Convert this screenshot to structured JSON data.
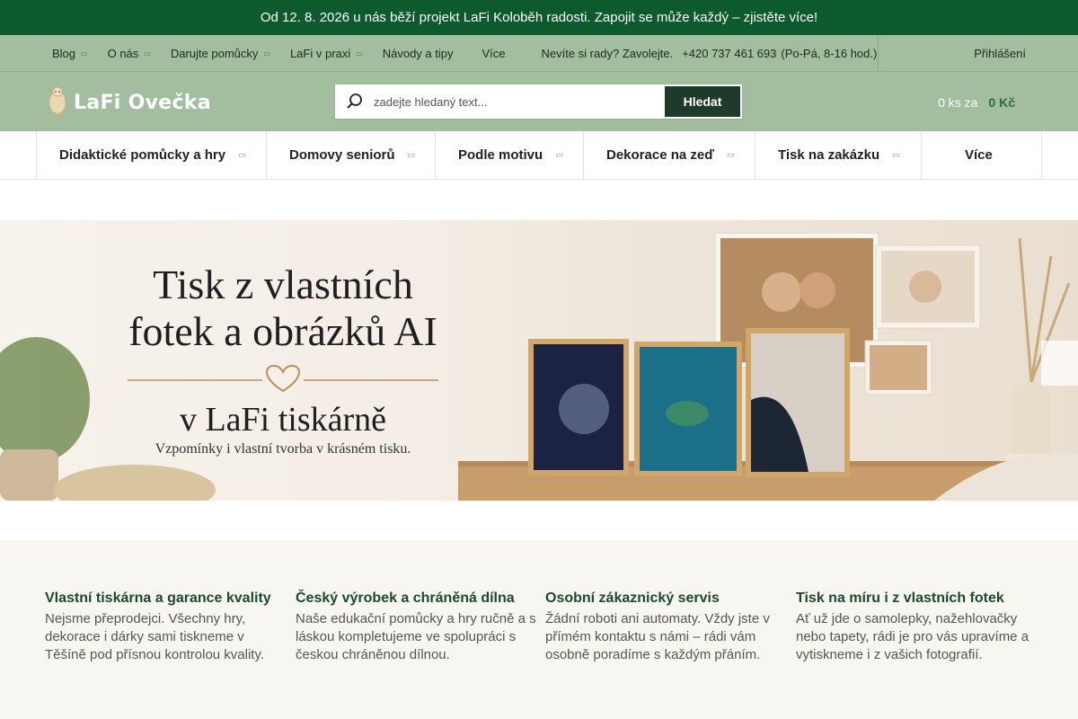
{
  "announcement": {
    "text": " Od 12. 8. 2026 u nás běží projekt LaFi Koloběh radosti. Zapojit se může každý – zjistěte více! ",
    "close": ""
  },
  "topnav": {
    "items": [
      {
        "label": "Blog",
        "caret": "▭"
      },
      {
        "label": "O nás",
        "caret": "▭"
      },
      {
        "label": "Darujte pomůcky",
        "caret": "▭"
      },
      {
        "label": "LaFi v praxi",
        "caret": "▭"
      },
      {
        "label": "Návody a tipy",
        "caret": ""
      }
    ],
    "more_icon": "",
    "more_label": "Více",
    "contact_prefix": "Nevíte si rady? Zavolejte.",
    "phone_icon": "",
    "phone": "+420 737 461 693",
    "hours": "(Po-Pá, 8-16 hod.)",
    "login_icon1": "",
    "login_icon2": "",
    "login_label": "Přihlášení"
  },
  "header": {
    "logo_text": "LaFi Ovečka",
    "search_placeholder": "zadejte hledaný text...",
    "search_button": "Hledat",
    "cart_count": "0 ks za",
    "cart_price": "0 Kč",
    "cart_icon": ""
  },
  "categories": [
    {
      "label": "Didaktické pomůcky a hry",
      "caret": "▭"
    },
    {
      "label": "Domovy seniorů",
      "caret": "▭"
    },
    {
      "label": "Podle motivu",
      "caret": "▭"
    },
    {
      "label": "Dekorace na zeď",
      "caret": "▭"
    },
    {
      "label": "Tisk na zakázku",
      "caret": "▭"
    }
  ],
  "categories_more": {
    "icon": "",
    "label": "Více"
  },
  "banner": {
    "title_line1": "Tisk z vlastních",
    "title_line2": "fotek a obrázků AI",
    "subtitle": "v LaFi tiskárně",
    "tagline": "Vzpomínky i vlastní tvorba v krásném tisku.",
    "next_icon": ""
  },
  "features": [
    {
      "title": "Vlastní tiskárna a garance kvality",
      "text": "Nejsme přeprodejci. Všechny hry, dekorace i dárky sami tiskneme v Těšíně pod přísnou kontrolou kvality."
    },
    {
      "title": "Český výrobek a chráněná dílna",
      "text": "Naše edukační pomůcky a hry ručně a s láskou kompletujeme ve spolupráci s českou chráněnou dílnou."
    },
    {
      "title": "Osobní zákaznický servis",
      "text": "Žádní roboti ani automaty. Vždy jste v přímém kontaktu s námi – rádi vám osobně poradíme s každým přáním."
    },
    {
      "title": "Tisk na míru i z vlastních fotek",
      "text": "Ať už jde o samolepky, nažehlovačky nebo tapety, rádi je pro vás upravíme a vytiskneme i z vašich fotografií."
    }
  ],
  "colors": {
    "announce_bg": "#0c5a2e",
    "nav_bg": "#a3bd9f",
    "accent": "#1c4a2e",
    "button_bg": "#1d3a2a"
  }
}
